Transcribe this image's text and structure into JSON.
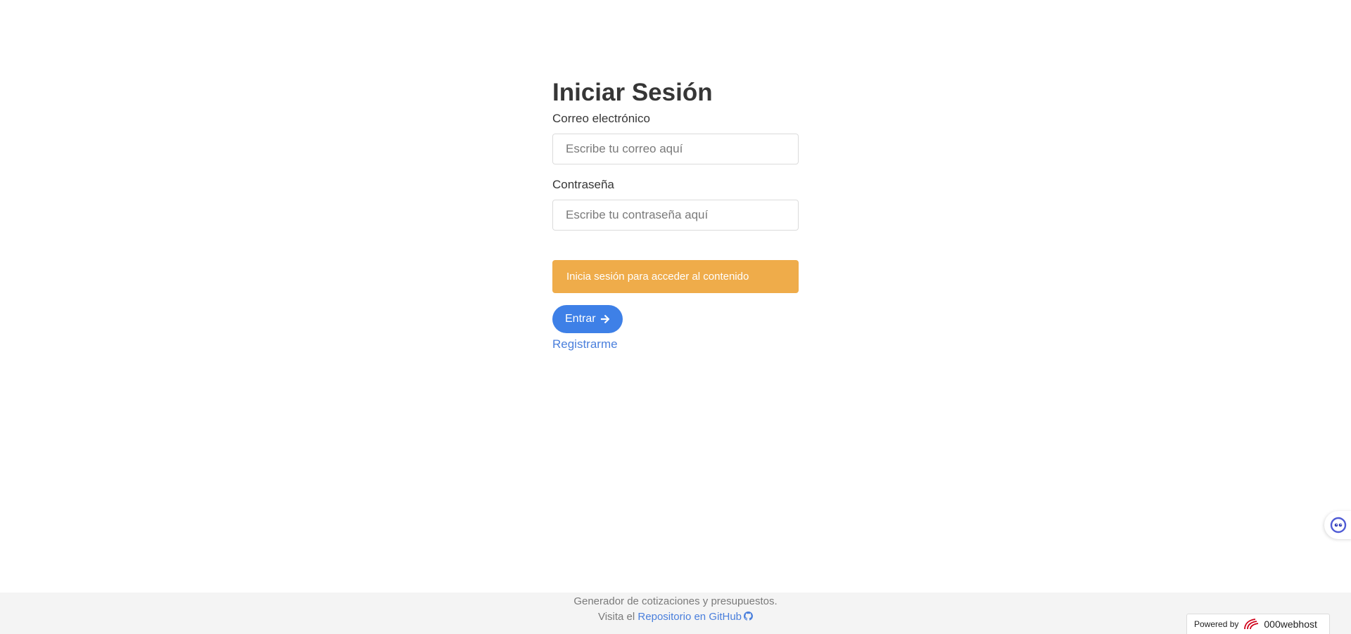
{
  "login": {
    "title": "Iniciar Sesión",
    "email_label": "Correo electrónico",
    "email_placeholder": "Escribe tu correo aquí",
    "email_value": "",
    "password_label": "Contraseña",
    "password_placeholder": "Escribe tu contraseña aquí",
    "password_value": "",
    "notice": "Inicia sesión para acceder al contenido",
    "submit_label": "Entrar",
    "submit_icon": "arrow-right-icon",
    "register_label": "Registrarme"
  },
  "footer": {
    "line1": "Generador de cotizaciones y presupuestos.",
    "line2_prefix": "Visita el",
    "repo_link": "Repositorio en GitHub",
    "repo_icon": "github-icon"
  },
  "badge": {
    "powered_by": "Powered by",
    "brand": "000webhost"
  },
  "colors": {
    "notice_bg": "#efac4a",
    "primary": "#3e80e7",
    "link": "#4a7fdc",
    "footer_bg": "#f4f4f4"
  }
}
